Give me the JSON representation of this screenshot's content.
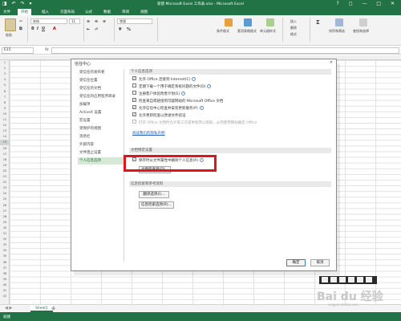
{
  "window": {
    "quick_access": "◨ ↶ ↷ ▾",
    "title": "新建 Microsoft Excel 工作表.xlsx - Microsoft Excel",
    "controls": "? ◻ — □ ✕"
  },
  "ribbon_tabs": [
    "文件",
    "开始",
    "插入",
    "页面布局",
    "公式",
    "数据",
    "审阅",
    "视图"
  ],
  "ribbon": {
    "font_name": "宋体",
    "font_size": "11",
    "number_format": "常规",
    "groups": [
      "粘贴",
      "条件格式",
      "套用表格格式",
      "单元格样式",
      "插入",
      "删除",
      "格式",
      "排序和筛选",
      "查找和选择"
    ]
  },
  "formula_bar": {
    "name_box": "E15",
    "fx": "fx",
    "value": ""
  },
  "sheet": {
    "rows": [
      "1",
      "2",
      "3",
      "4",
      "5",
      "6",
      "7",
      "8",
      "9",
      "10",
      "11",
      "12",
      "13",
      "14",
      "15",
      "16",
      "17",
      "18",
      "19",
      "20",
      "21",
      "22",
      "23",
      "24",
      "25",
      "26",
      "27",
      "28",
      "29",
      "30",
      "31",
      "32",
      "33",
      "34",
      "35",
      "36",
      "37",
      "38",
      "39",
      "40",
      "41",
      "42"
    ],
    "selected_row": "15",
    "tab_name": "Sheet1",
    "nav_arrows": "◀ ▶",
    "status": "就绪"
  },
  "dialog": {
    "title": "信任中心",
    "nav_items": [
      "受信任的发布者",
      "受信任位置",
      "受信任的文档",
      "受信任的应用程序目录",
      "加载项",
      "ActiveX 设置",
      "宏设置",
      "受保护的视图",
      "消息栏",
      "外部内容",
      "文件阻止设置",
      "个人信息选项"
    ],
    "active_nav": "个人信息选项",
    "section_privacy": "个人信息选项",
    "privacy_options": [
      {
        "label": "允许 Office 连接到 Internet(C)",
        "checked": true,
        "disabled": false
      },
      {
        "label": "定期下载一个用于确定系统问题的文件(D)",
        "checked": false,
        "disabled": false
      },
      {
        "label": "注册客户体验改善计划(E)",
        "checked": false,
        "disabled": false
      },
      {
        "label": "检查来自或链接到可疑网站的 Microsoft Office 文档",
        "checked": true,
        "disabled": false
      },
      {
        "label": "允许信任中心检查并安装更新服务(P)",
        "checked": true,
        "disabled": false
      },
      {
        "label": "允许更新检查以改进文件验证",
        "checked": true,
        "disabled": false
      },
      {
        "label": "打开 Office 文档时允许第三方提供程序以帮助...从而使用网站确定 Office",
        "checked": false,
        "disabled": true
      }
    ],
    "privacy_link": "阅读我们的隐私声明",
    "section_doc": "文档特定设置",
    "doc_option": "保存时从文件属性中删除个人信息(R)",
    "doc_button": "文档检查器(D)...",
    "section_research": "信息检索和参考资料",
    "translate_button": "翻译选项(I)...",
    "research_button": "信息检索选项(R)...",
    "ok": "确定",
    "cancel": "取消"
  },
  "watermark": {
    "text": "Bai du 经验",
    "sub": "jingyan.baidu.com"
  }
}
